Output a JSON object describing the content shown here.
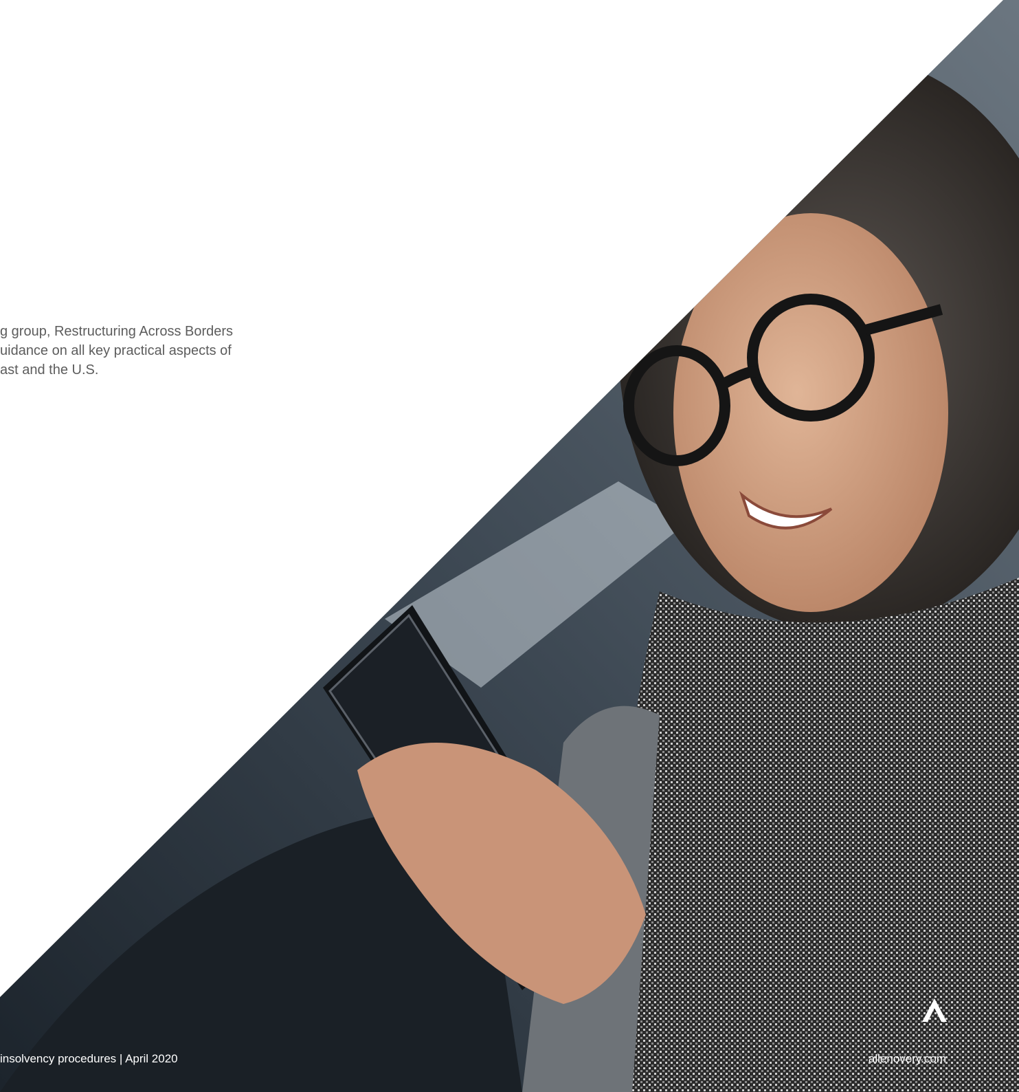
{
  "intro": {
    "lines": [
      "g group, Restructuring Across Borders",
      "uidance on all key practical aspects of",
      "ast and the U.S."
    ]
  },
  "footer": {
    "left_text": "insolvency procedures | April 2020",
    "right_text": "allenovery.com"
  },
  "image": {
    "subject": "photo-woman-with-glasses-using-phone-in-car",
    "logo": "ao-chevron-logo"
  },
  "colors": {
    "body_text": "#5c5c5c",
    "footer_text": "#ffffff",
    "photo_dark": "#1f2730",
    "photo_mid": "#4a5560"
  }
}
